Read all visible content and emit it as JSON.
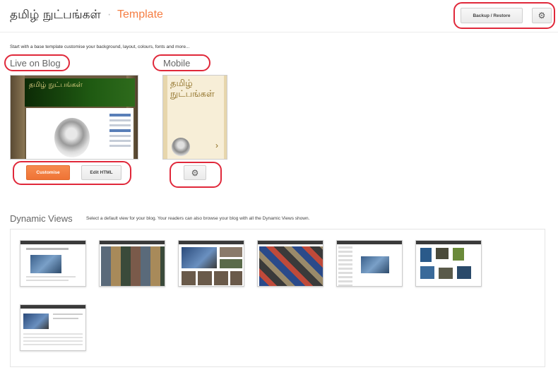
{
  "header": {
    "blog_name": "தமிழ் நுட்பங்கள்",
    "separator": "·",
    "page_title": "Template",
    "backup_label": "Backup / Restore",
    "settings_icon": "gear-icon"
  },
  "intro": "Start with a base template customise your background, layout, colours, fonts and more...",
  "live": {
    "title": "Live on Blog",
    "preview_title": "தமிழ் நுட்பங்கள்",
    "customise_label": "Customise",
    "edit_html_label": "Edit HTML"
  },
  "mobile": {
    "title": "Mobile",
    "preview_title": "தமிழ் நுட்பங்கள்",
    "settings_icon": "gear-icon"
  },
  "dynamic": {
    "title": "Dynamic Views",
    "description": "Select a default view for your blog. Your readers can also browse your blog with all the Dynamic Views shown."
  },
  "colors": {
    "accent": "#f57d42",
    "highlight": "#e0283a"
  }
}
